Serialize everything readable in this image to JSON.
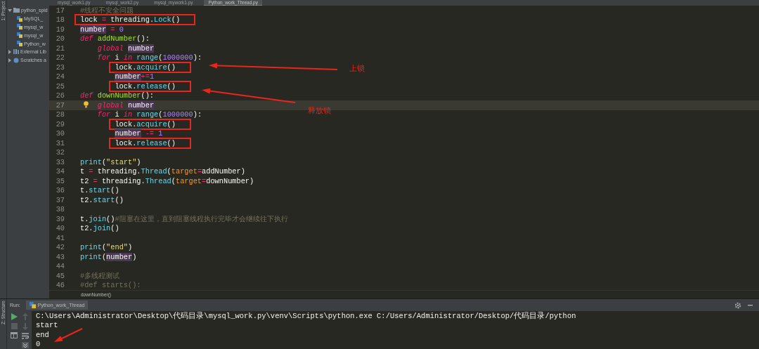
{
  "left_strip": {
    "top_label": "1: Project",
    "bottom_label": "Z: Structure"
  },
  "project_tree": [
    {
      "label": "python_spid",
      "kind": "folder",
      "expanded": true,
      "children": [
        {
          "label": "MySQL_",
          "kind": "file"
        },
        {
          "label": "mysql_w",
          "kind": "file"
        },
        {
          "label": "mysql_w",
          "kind": "file"
        },
        {
          "label": "Python_w",
          "kind": "file"
        }
      ]
    },
    {
      "label": "External Lib",
      "kind": "library",
      "expanded": false
    },
    {
      "label": "Scratches a",
      "kind": "scratches",
      "expanded": false
    }
  ],
  "editor_tabs": [
    {
      "label": "mysql_work1.py",
      "selected": false
    },
    {
      "label": "mysql_work2.py",
      "selected": false
    },
    {
      "label": "mysql_mywork1.py",
      "selected": false
    },
    {
      "label": "Python_work_Thread.py",
      "selected": true
    }
  ],
  "code_lines": [
    {
      "n": "17",
      "tokens": [
        {
          "kind": "comment",
          "text": "#线程不安全问题"
        }
      ]
    },
    {
      "n": "18",
      "boxed": true,
      "tokens": [
        {
          "kind": "plain",
          "text": "lock"
        },
        {
          "kind": "operator",
          "text": " = "
        },
        {
          "kind": "plain",
          "text": "threading."
        },
        {
          "kind": "call",
          "text": "Lock"
        },
        {
          "kind": "plain",
          "text": "()"
        }
      ]
    },
    {
      "n": "19",
      "tokens": [
        {
          "kind": "variable",
          "text": "number"
        },
        {
          "kind": "operator",
          "text": " = "
        },
        {
          "kind": "number",
          "text": "0"
        }
      ]
    },
    {
      "n": "20",
      "tokens": [
        {
          "kind": "keyword",
          "text": "def "
        },
        {
          "kind": "function",
          "text": "addNumber"
        },
        {
          "kind": "plain",
          "text": "():"
        }
      ]
    },
    {
      "n": "21",
      "tokens": [
        {
          "kind": "keyword",
          "text": "    global "
        },
        {
          "kind": "variable",
          "text": "number"
        }
      ]
    },
    {
      "n": "22",
      "tokens": [
        {
          "kind": "keyword",
          "text": "    for"
        },
        {
          "kind": "plain",
          "text": " i "
        },
        {
          "kind": "keyword",
          "text": "in "
        },
        {
          "kind": "call",
          "text": "range"
        },
        {
          "kind": "plain",
          "text": "("
        },
        {
          "kind": "number",
          "text": "1000000"
        },
        {
          "kind": "plain",
          "text": "):"
        }
      ]
    },
    {
      "n": "23",
      "boxed": true,
      "tokens": [
        {
          "kind": "plain",
          "text": "        lock."
        },
        {
          "kind": "call",
          "text": "acquire"
        },
        {
          "kind": "plain",
          "text": "()"
        }
      ]
    },
    {
      "n": "24",
      "tokens": [
        {
          "kind": "variable",
          "text": "        number"
        },
        {
          "kind": "operator",
          "text": "+="
        },
        {
          "kind": "number",
          "text": "1"
        }
      ]
    },
    {
      "n": "25",
      "boxed": true,
      "tokens": [
        {
          "kind": "plain",
          "text": "        lock."
        },
        {
          "kind": "call",
          "text": "release"
        },
        {
          "kind": "plain",
          "text": "()"
        }
      ]
    },
    {
      "n": "26",
      "tokens": [
        {
          "kind": "keyword",
          "text": "def "
        },
        {
          "kind": "function",
          "text": "downNumber"
        },
        {
          "kind": "plain",
          "text": "():"
        }
      ]
    },
    {
      "n": "27",
      "current": true,
      "bulb": true,
      "tokens": [
        {
          "kind": "keyword",
          "text": "    global "
        },
        {
          "kind": "variable",
          "text": "number"
        }
      ]
    },
    {
      "n": "28",
      "tokens": [
        {
          "kind": "keyword",
          "text": "    for"
        },
        {
          "kind": "plain",
          "text": " i "
        },
        {
          "kind": "keyword",
          "text": "in "
        },
        {
          "kind": "call",
          "text": "range"
        },
        {
          "kind": "plain",
          "text": "("
        },
        {
          "kind": "number",
          "text": "1000000"
        },
        {
          "kind": "plain",
          "text": "):"
        }
      ]
    },
    {
      "n": "29",
      "boxed": true,
      "tokens": [
        {
          "kind": "plain",
          "text": "        lock."
        },
        {
          "kind": "call",
          "text": "acquire"
        },
        {
          "kind": "plain",
          "text": "()"
        }
      ]
    },
    {
      "n": "30",
      "tokens": [
        {
          "kind": "variable",
          "text": "        number"
        },
        {
          "kind": "operator",
          "text": " -= "
        },
        {
          "kind": "number",
          "text": "1"
        }
      ]
    },
    {
      "n": "31",
      "boxed": true,
      "tokens": [
        {
          "kind": "plain",
          "text": "        lock."
        },
        {
          "kind": "call",
          "text": "release"
        },
        {
          "kind": "plain",
          "text": "()"
        }
      ]
    },
    {
      "n": "32"
    },
    {
      "n": "33",
      "tokens": [
        {
          "kind": "call",
          "text": "print"
        },
        {
          "kind": "plain",
          "text": "("
        },
        {
          "kind": "string",
          "text": "\"start\""
        },
        {
          "kind": "plain",
          "text": ")"
        }
      ]
    },
    {
      "n": "34",
      "tokens": [
        {
          "kind": "plain",
          "text": "t"
        },
        {
          "kind": "operator",
          "text": " = "
        },
        {
          "kind": "plain",
          "text": "threading."
        },
        {
          "kind": "call",
          "text": "Thread"
        },
        {
          "kind": "plain",
          "text": "("
        },
        {
          "kind": "argument",
          "text": "target"
        },
        {
          "kind": "operator",
          "text": "="
        },
        {
          "kind": "plain",
          "text": "addNumber)"
        }
      ]
    },
    {
      "n": "35",
      "tokens": [
        {
          "kind": "plain",
          "text": "t2"
        },
        {
          "kind": "operator",
          "text": " = "
        },
        {
          "kind": "plain",
          "text": "threading."
        },
        {
          "kind": "call",
          "text": "Thread"
        },
        {
          "kind": "plain",
          "text": "("
        },
        {
          "kind": "argument",
          "text": "target"
        },
        {
          "kind": "operator",
          "text": "="
        },
        {
          "kind": "plain",
          "text": "downNumber)"
        }
      ]
    },
    {
      "n": "36",
      "tokens": [
        {
          "kind": "plain",
          "text": "t."
        },
        {
          "kind": "call",
          "text": "start"
        },
        {
          "kind": "plain",
          "text": "()"
        }
      ]
    },
    {
      "n": "37",
      "tokens": [
        {
          "kind": "plain",
          "text": "t2."
        },
        {
          "kind": "call",
          "text": "start"
        },
        {
          "kind": "plain",
          "text": "()"
        }
      ]
    },
    {
      "n": "38"
    },
    {
      "n": "39",
      "tokens": [
        {
          "kind": "plain",
          "text": "t."
        },
        {
          "kind": "call",
          "text": "join"
        },
        {
          "kind": "plain",
          "text": "()"
        },
        {
          "kind": "comment",
          "text": "#阻塞在这里，直到阻塞线程执行完毕才会继续往下执行"
        }
      ]
    },
    {
      "n": "40",
      "tokens": [
        {
          "kind": "plain",
          "text": "t2."
        },
        {
          "kind": "call",
          "text": "join"
        },
        {
          "kind": "plain",
          "text": "()"
        }
      ]
    },
    {
      "n": "41"
    },
    {
      "n": "42",
      "tokens": [
        {
          "kind": "call",
          "text": "print"
        },
        {
          "kind": "plain",
          "text": "("
        },
        {
          "kind": "string",
          "text": "\"end\""
        },
        {
          "kind": "plain",
          "text": ")"
        }
      ]
    },
    {
      "n": "43",
      "tokens": [
        {
          "kind": "call",
          "text": "print"
        },
        {
          "kind": "plain",
          "text": "("
        },
        {
          "kind": "variable",
          "text": "number"
        },
        {
          "kind": "plain",
          "text": ")"
        }
      ]
    },
    {
      "n": "44"
    },
    {
      "n": "45",
      "tokens": [
        {
          "kind": "comment",
          "text": "#多线程测试"
        }
      ]
    },
    {
      "n": "46",
      "tokens": [
        {
          "kind": "comment",
          "text": "#def starts():"
        }
      ]
    }
  ],
  "breadcrumb": "downNumber()",
  "annotations": [
    {
      "text": "上锁"
    },
    {
      "text": "释放锁"
    }
  ],
  "run_panel": {
    "label": "Run:",
    "tab": "Python_work_Thread",
    "output": [
      "C:\\Users\\Administrator\\Desktop\\代码目录\\mysql_work.py\\venv\\Scripts\\python.exe C:/Users/Administrator/Desktop/代码目录/python",
      "start",
      "end",
      "0"
    ]
  }
}
